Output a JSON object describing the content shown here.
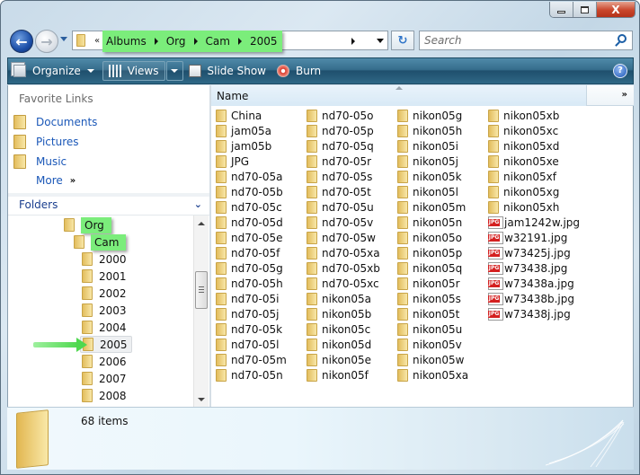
{
  "window": {
    "caption_buttons": [
      "minimize",
      "maximize",
      "close"
    ],
    "close_glyph": "X"
  },
  "nav": {
    "back_glyph": "←",
    "forward_glyph": "→",
    "overflow_chevron": "«",
    "breadcrumbs": [
      "Albums",
      "Org",
      "Cam",
      "2005"
    ],
    "refresh_glyph": "↻",
    "search_placeholder": "Search"
  },
  "toolbar": {
    "organize_label": "Organize",
    "views_label": "Views",
    "slideshow_label": "Slide Show",
    "burn_label": "Burn",
    "help_glyph": "?"
  },
  "navpane": {
    "favorites_title": "Favorite Links",
    "favorites": [
      {
        "label": "Documents",
        "icon": "documents-folder-icon"
      },
      {
        "label": "Pictures",
        "icon": "pictures-folder-icon"
      },
      {
        "label": "Music",
        "icon": "music-folder-icon"
      }
    ],
    "more_label": "More",
    "more_chevron": "»",
    "folders_title": "Folders",
    "folders_chevron": "⌄",
    "tree": [
      {
        "label": "Org",
        "level": 0,
        "highlighted": true
      },
      {
        "label": "Cam",
        "level": 1,
        "highlighted": true
      },
      {
        "label": "2000",
        "level": 2
      },
      {
        "label": "2001",
        "level": 2
      },
      {
        "label": "2002",
        "level": 2
      },
      {
        "label": "2003",
        "level": 2
      },
      {
        "label": "2004",
        "level": 2
      },
      {
        "label": "2005",
        "level": 2,
        "selected": true
      },
      {
        "label": "2006",
        "level": 2
      },
      {
        "label": "2007",
        "level": 2
      },
      {
        "label": "2008",
        "level": 2
      }
    ]
  },
  "filelist": {
    "column_name": "Name",
    "column_more": "»",
    "columns": [
      [
        "China",
        "jam05a",
        "jam05b",
        "JPG",
        "nd70-05a",
        "nd70-05b",
        "nd70-05c",
        "nd70-05d",
        "nd70-05e",
        "nd70-05f",
        "nd70-05g",
        "nd70-05h",
        "nd70-05i",
        "nd70-05j",
        "nd70-05k",
        "nd70-05l",
        "nd70-05m",
        "nd70-05n"
      ],
      [
        "nd70-05o",
        "nd70-05p",
        "nd70-05q",
        "nd70-05r",
        "nd70-05s",
        "nd70-05t",
        "nd70-05u",
        "nd70-05v",
        "nd70-05w",
        "nd70-05xa",
        "nd70-05xb",
        "nd70-05xc",
        "nikon05a",
        "nikon05b",
        "nikon05c",
        "nikon05d",
        "nikon05e",
        "nikon05f"
      ],
      [
        "nikon05g",
        "nikon05h",
        "nikon05i",
        "nikon05j",
        "nikon05k",
        "nikon05l",
        "nikon05m",
        "nikon05n",
        "nikon05o",
        "nikon05p",
        "nikon05q",
        "nikon05r",
        "nikon05s",
        "nikon05t",
        "nikon05u",
        "nikon05v",
        "nikon05w",
        "nikon05xa"
      ],
      [
        "nikon05xb",
        "nikon05xc",
        "nikon05xd",
        "nikon05xe",
        "nikon05xf",
        "nikon05xg",
        "nikon05xh",
        "jam1242w.jpg",
        "w32191.jpg",
        "w73425j.jpg",
        "w73438.jpg",
        "w73438a.jpg",
        "w73438b.jpg",
        "w73438j.jpg"
      ]
    ]
  },
  "details": {
    "item_count": "68 items"
  },
  "colors": {
    "highlight": "#7bed7b",
    "link": "#1b58b8",
    "toolbar": "#2f6886"
  }
}
